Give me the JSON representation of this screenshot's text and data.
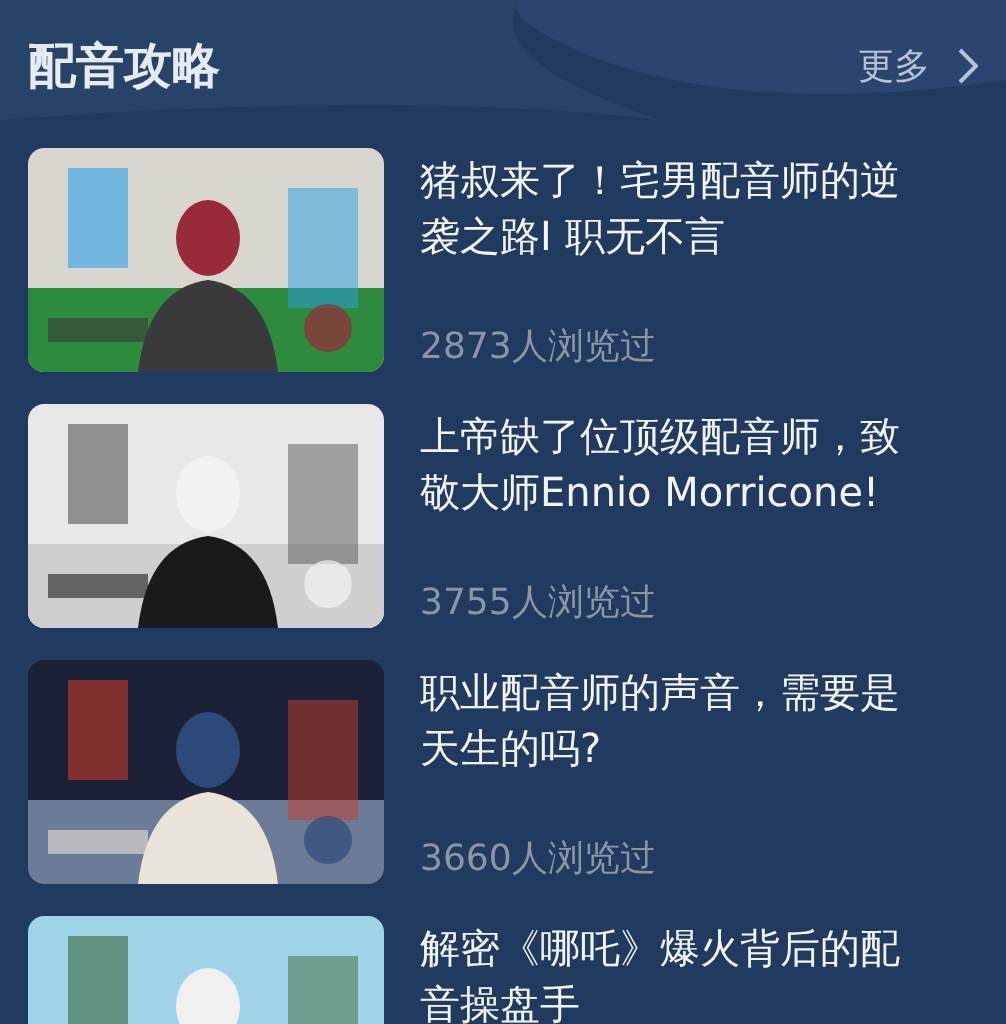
{
  "header": {
    "title": "配音攻略",
    "more": "更多"
  },
  "articles": [
    {
      "title": "猪叔来了！宅男配音师的逆袭之路I 职无不言",
      "views": "2873人浏览过"
    },
    {
      "title": "上帝缺了位顶级配音师，致敬大师Ennio Morricone!",
      "views": "3755人浏览过"
    },
    {
      "title": "职业配音师的声音，需要是天生的吗?",
      "views": "3660人浏览过"
    },
    {
      "title": "解密《哪吒》爆火背后的配音操盘手"
    }
  ]
}
